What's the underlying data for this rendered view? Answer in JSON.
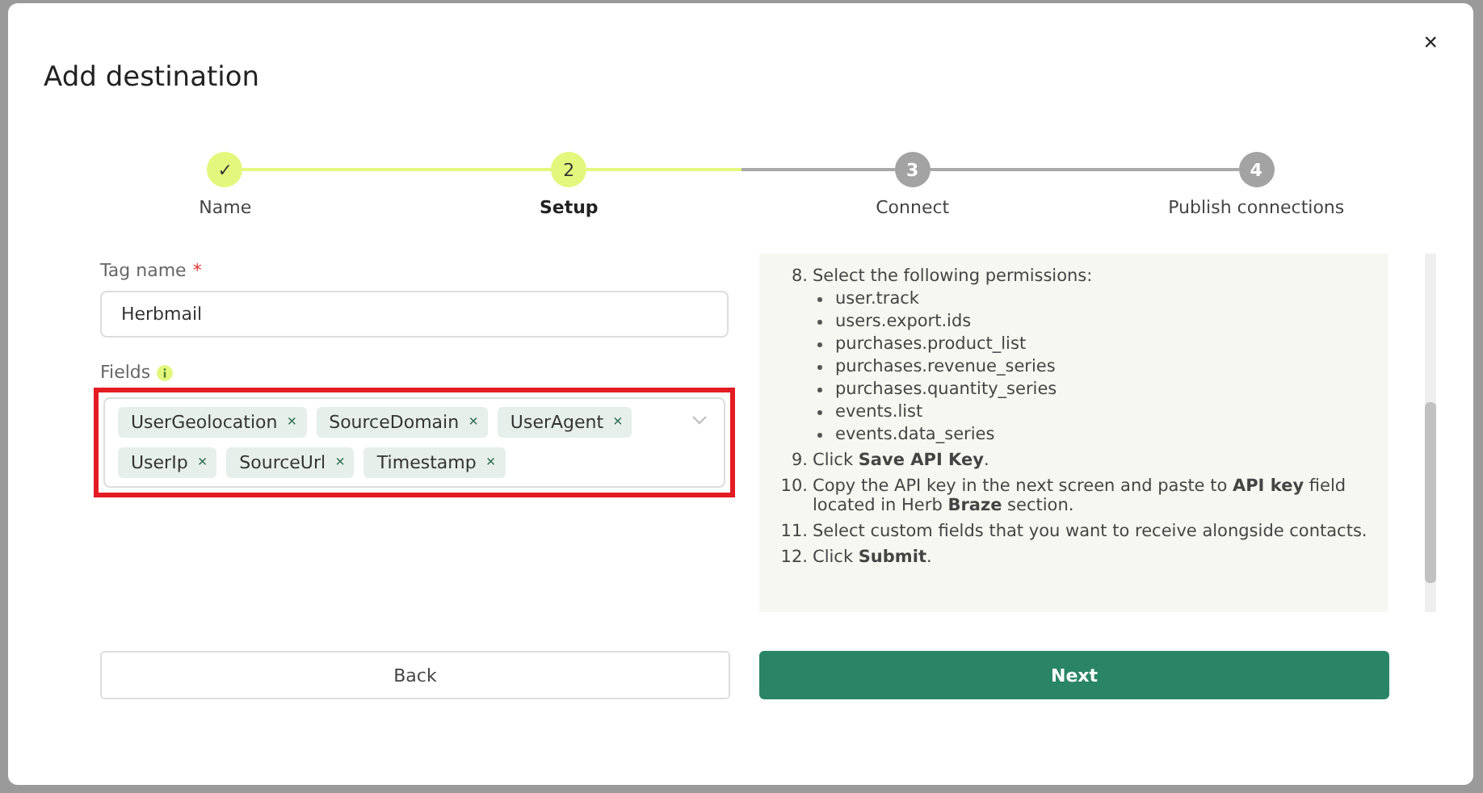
{
  "dialog": {
    "title": "Add destination",
    "close": "×"
  },
  "steps": [
    {
      "marker": "✓",
      "label": "Name",
      "selected": false
    },
    {
      "marker": "2",
      "label": "Setup",
      "selected": true
    },
    {
      "marker": "3",
      "label": "Connect",
      "selected": false
    },
    {
      "marker": "4",
      "label": "Publish connections",
      "selected": false
    }
  ],
  "form": {
    "tag_name": {
      "label": "Tag name",
      "required_mark": "*",
      "value": "Herbmail"
    },
    "fields": {
      "label": "Fields",
      "highlighted": true,
      "tags": [
        {
          "text": "UserGeolocation",
          "remove": "×"
        },
        {
          "text": "SourceDomain",
          "remove": "×"
        },
        {
          "text": "UserAgent",
          "remove": "×"
        },
        {
          "text": "UserIp",
          "remove": "×"
        },
        {
          "text": "SourceUrl",
          "remove": "×"
        },
        {
          "text": "Timestamp",
          "remove": "×"
        }
      ]
    }
  },
  "instructions": [
    {
      "number": "8.",
      "text": "Select the following permissions:",
      "bullets": [
        "user.track",
        "users.export.ids",
        "purchases.product_list",
        "purchases.revenue_series",
        "purchases.quantity_series",
        "events.list",
        "events.data_series"
      ]
    },
    {
      "number": "9.",
      "text": "Click **Save API Key**."
    },
    {
      "number": "10.",
      "text": "Copy the API key in the next screen and paste to **API key** field located in Herb **Braze** section."
    },
    {
      "number": "11.",
      "text": "Select custom fields that you want to receive alongside contacts."
    },
    {
      "number": "12.",
      "text": "Click **Submit**."
    }
  ],
  "buttons": [
    {
      "label": "Back",
      "kind": "secondary"
    },
    {
      "label": "Next",
      "kind": "primary"
    }
  ]
}
